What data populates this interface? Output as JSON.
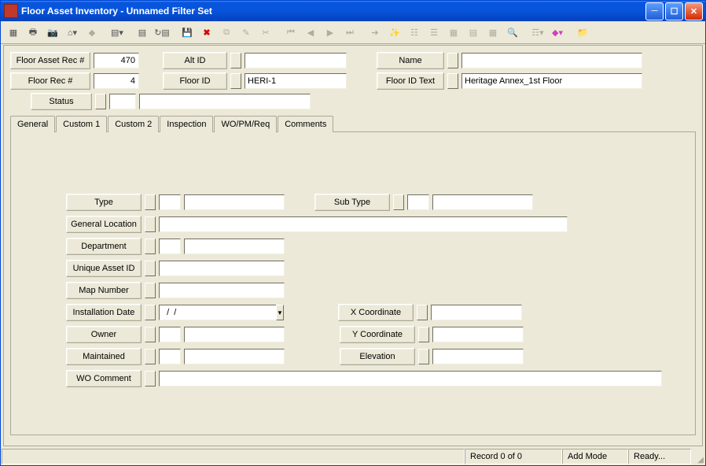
{
  "window": {
    "title": "Floor Asset Inventory - Unnamed Filter Set"
  },
  "header": {
    "floor_asset_rec_lbl": "Floor Asset Rec #",
    "floor_asset_rec_val": "470",
    "alt_id_lbl": "Alt ID",
    "alt_id_val": "",
    "name_lbl": "Name",
    "name_val": "",
    "floor_rec_lbl": "Floor Rec #",
    "floor_rec_val": "4",
    "floor_id_lbl": "Floor ID",
    "floor_id_val": "HERI-1",
    "floor_id_text_lbl": "Floor ID Text",
    "floor_id_text_val": "Heritage Annex_1st Floor",
    "status_lbl": "Status",
    "status_code": "",
    "status_text": ""
  },
  "tabs": [
    "General",
    "Custom 1",
    "Custom 2",
    "Inspection",
    "WO/PM/Req",
    "Comments"
  ],
  "general": {
    "type_lbl": "Type",
    "type_code": "",
    "type_text": "",
    "subtype_lbl": "Sub Type",
    "subtype_code": "",
    "subtype_text": "",
    "gen_loc_lbl": "General Location",
    "gen_loc_val": "",
    "dept_lbl": "Department",
    "dept_code": "",
    "dept_text": "",
    "unique_id_lbl": "Unique Asset ID",
    "unique_id_val": "",
    "map_lbl": "Map Number",
    "map_val": "",
    "install_lbl": "Installation Date",
    "install_val": "  /  /",
    "xcoord_lbl": "X Coordinate",
    "xcoord_val": "",
    "owner_lbl": "Owner",
    "owner_code": "",
    "owner_text": "",
    "ycoord_lbl": "Y Coordinate",
    "ycoord_val": "",
    "maint_lbl": "Maintained",
    "maint_code": "",
    "maint_text": "",
    "elev_lbl": "Elevation",
    "elev_val": "",
    "wocomment_lbl": "WO Comment",
    "wocomment_val": ""
  },
  "statusbar": {
    "record": "Record 0 of 0",
    "mode": "Add Mode",
    "ready": "Ready..."
  }
}
